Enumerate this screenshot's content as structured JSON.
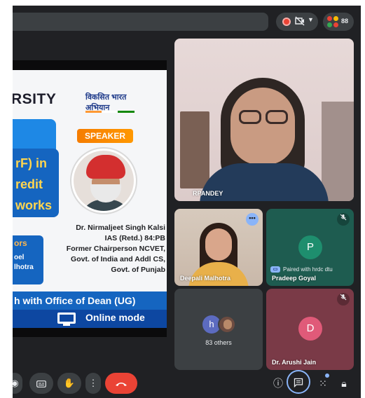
{
  "topbar": {
    "participants_count": "88"
  },
  "colors": {
    "background": "#202124",
    "accent": "#8ab4f8",
    "end_call": "#ea4335",
    "tile_pradeep": "#1e5c50",
    "tile_arushi": "#7a3a47"
  },
  "slide": {
    "university_fragment": "RSITY",
    "logo_line1": "विकसित भारत",
    "logo_line2": "अभियान",
    "speaker_tag": "SPEAKER",
    "title_fragment": "rF) in\nredit\nworks",
    "coordinators_fragment": "ors",
    "coordinator1_fragment": "oel",
    "coordinator2_fragment": "lhotra",
    "speaker_lines": [
      "Dr. Nirmaljeet Singh Kalsi",
      "IAS (Retd.) 84:PB",
      "Former Chairperson NCVET,",
      "Govt. of India and Addl CS,",
      "Govt. of Punjab"
    ],
    "collab_band": "h with Office of Dean (UG)",
    "mode_text": "Online mode"
  },
  "tiles": {
    "pandey": {
      "name": "RPANDEY"
    },
    "deepali": {
      "name": "Deepali Malhotra"
    },
    "pradeep": {
      "name": "Pradeep Goyal",
      "initial": "P",
      "paired_text": "Paired with hrdc dtu"
    },
    "others": {
      "initial": "h",
      "label": "83 others"
    },
    "arushi": {
      "name": "Dr. Arushi Jain",
      "initial": "D"
    }
  },
  "icons": {
    "record": "record-icon",
    "camera_off": "camera-off-icon",
    "people": "people-icon",
    "captions": "captions-icon",
    "raise_hand": "raise-hand-icon",
    "more": "more-vert-icon",
    "end_call": "end-call-icon",
    "info": "info-icon",
    "chat": "chat-icon",
    "activities": "activities-icon",
    "host_controls": "host-controls-icon",
    "mic_off": "mic-off-icon",
    "pin": "pin-icon"
  }
}
